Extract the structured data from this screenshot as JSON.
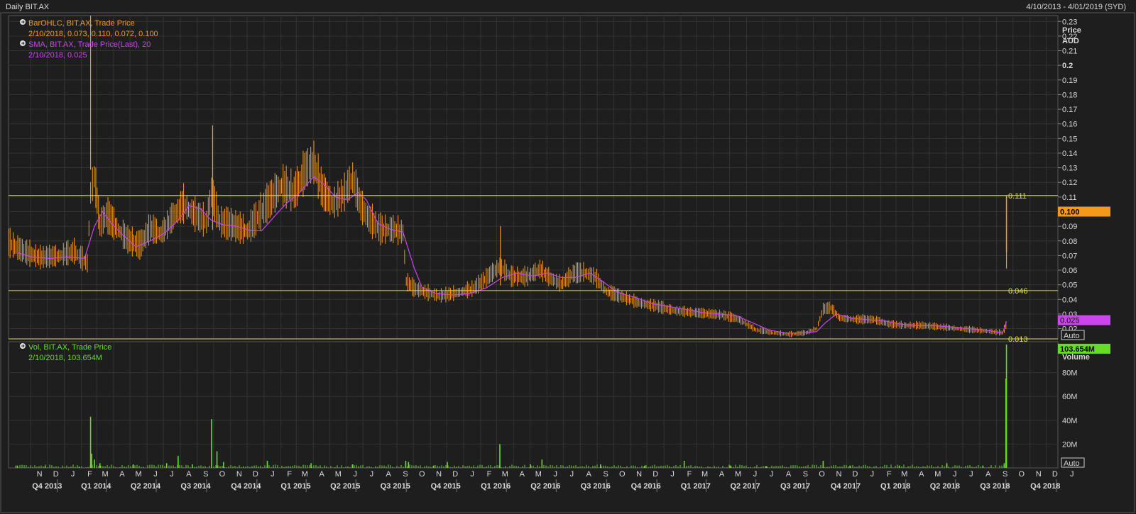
{
  "header": {
    "title": "Daily BIT.AX",
    "date_range": "4/10/2013 - 4/01/2019 (SYD)"
  },
  "legend": {
    "ohlc_line1": "BarOHLC, BIT.AX, Trade Price",
    "ohlc_line2": "2/10/2018, 0.073, 0.110, 0.072, 0.100",
    "sma_line1": "SMA, BIT.AX, Trade Price(Last),  20",
    "sma_line2": "2/10/2018, 0.025",
    "vol_line1": "Vol, BIT.AX, Trade Price",
    "vol_line2": "2/10/2018, 103.654M"
  },
  "price_axis": {
    "label": "Price",
    "unit": "AUD",
    "ticks": [
      "0.23",
      "0.22",
      "0.21",
      "0.2",
      "0.19",
      "0.18",
      "0.17",
      "0.16",
      "0.15",
      "0.14",
      "0.13",
      "0.12",
      "0.11",
      "0.1",
      "0.09",
      "0.08",
      "0.07",
      "0.06",
      "0.05",
      "0.04",
      "0.03",
      "0.02"
    ],
    "last_price": "0.100",
    "last_sma": "0.025",
    "auto_label": "Auto"
  },
  "volume_axis": {
    "label": "Volume",
    "ticks": [
      "80M",
      "60M",
      "40M",
      "20M"
    ],
    "last_volume": "103.654M",
    "auto_label": "Auto"
  },
  "h_lines": [
    {
      "value": 0.111,
      "label": "0.111"
    },
    {
      "value": 0.046,
      "label": "0.046"
    },
    {
      "value": 0.013,
      "label": "0.013"
    }
  ],
  "x_axis": {
    "months": [
      "N",
      "D",
      "J",
      "F",
      "M",
      "A",
      "M",
      "J",
      "J",
      "A",
      "S",
      "O",
      "N",
      "D",
      "J",
      "F",
      "M",
      "A",
      "M",
      "J",
      "J",
      "A",
      "S",
      "O",
      "N",
      "D",
      "J",
      "F",
      "M",
      "A",
      "M",
      "J",
      "J",
      "A",
      "S",
      "O",
      "N",
      "D",
      "J",
      "F",
      "M",
      "A",
      "M",
      "J",
      "J",
      "A",
      "S",
      "O",
      "N",
      "D",
      "J",
      "F",
      "M",
      "A",
      "M",
      "J",
      "J",
      "A",
      "S",
      "O",
      "N",
      "D",
      "J"
    ],
    "quarters": [
      "Q4 2013",
      "Q1 2014",
      "Q2 2014",
      "Q3 2014",
      "Q4 2014",
      "Q1 2015",
      "Q2 2015",
      "Q3 2015",
      "Q4 2015",
      "Q1 2016",
      "Q2 2016",
      "Q3 2016",
      "Q4 2016",
      "Q1 2017",
      "Q2 2017",
      "Q3 2017",
      "Q4 2017",
      "Q1 2018",
      "Q2 2018",
      "Q3 2018",
      "Q4 2018"
    ]
  },
  "colors": {
    "background": "#1e1e1e",
    "grid": "#333333",
    "ohlc": "#f39a1c",
    "sma": "#cc44ee",
    "volume": "#66dd22",
    "hline": "#e6e62a",
    "axis_text": "#d8d8d8"
  },
  "chart_data": {
    "type": "line",
    "title": "Daily BIT.AX",
    "x_range": [
      "2013-10-04",
      "2019-01-04"
    ],
    "price_ylim": [
      0.013,
      0.234
    ],
    "volume_ylim": [
      0,
      100000000
    ],
    "series": [
      {
        "name": "BarOHLC, BIT.AX, Trade Price",
        "kind": "ohlc-close",
        "points": [
          [
            "2013-10-04",
            0.078
          ],
          [
            "2013-11-01",
            0.072
          ],
          [
            "2013-12-01",
            0.068
          ],
          [
            "2014-01-01",
            0.069
          ],
          [
            "2014-02-01",
            0.072
          ],
          [
            "2014-02-25",
            0.064
          ],
          [
            "2014-03-03",
            0.112
          ],
          [
            "2014-03-10",
            0.123
          ],
          [
            "2014-03-20",
            0.09
          ],
          [
            "2014-04-01",
            0.097
          ],
          [
            "2014-04-20",
            0.088
          ],
          [
            "2014-05-10",
            0.08
          ],
          [
            "2014-06-01",
            0.076
          ],
          [
            "2014-06-20",
            0.088
          ],
          [
            "2014-07-10",
            0.084
          ],
          [
            "2014-08-01",
            0.096
          ],
          [
            "2014-08-20",
            0.104
          ],
          [
            "2014-09-10",
            0.097
          ],
          [
            "2014-10-01",
            0.092
          ],
          [
            "2014-10-10",
            0.112
          ],
          [
            "2014-10-25",
            0.092
          ],
          [
            "2014-11-15",
            0.09
          ],
          [
            "2014-12-15",
            0.086
          ],
          [
            "2015-01-05",
            0.097
          ],
          [
            "2015-01-25",
            0.107
          ],
          [
            "2015-02-15",
            0.117
          ],
          [
            "2015-03-10",
            0.112
          ],
          [
            "2015-04-01",
            0.128
          ],
          [
            "2015-04-15",
            0.132
          ],
          [
            "2015-05-01",
            0.113
          ],
          [
            "2015-05-20",
            0.104
          ],
          [
            "2015-06-10",
            0.112
          ],
          [
            "2015-06-25",
            0.122
          ],
          [
            "2015-07-10",
            0.103
          ],
          [
            "2015-07-25",
            0.094
          ],
          [
            "2015-08-15",
            0.087
          ],
          [
            "2015-09-10",
            0.087
          ],
          [
            "2015-09-25",
            0.085
          ],
          [
            "2015-10-01",
            0.052
          ],
          [
            "2015-10-15",
            0.047
          ],
          [
            "2015-11-10",
            0.044
          ],
          [
            "2015-12-01",
            0.042
          ],
          [
            "2016-01-01",
            0.044
          ],
          [
            "2016-02-01",
            0.047
          ],
          [
            "2016-03-01",
            0.056
          ],
          [
            "2016-03-20",
            0.062
          ],
          [
            "2016-04-10",
            0.055
          ],
          [
            "2016-05-10",
            0.055
          ],
          [
            "2016-06-01",
            0.06
          ],
          [
            "2016-06-20",
            0.054
          ],
          [
            "2016-07-10",
            0.05
          ],
          [
            "2016-08-01",
            0.057
          ],
          [
            "2016-08-20",
            0.058
          ],
          [
            "2016-09-10",
            0.055
          ],
          [
            "2016-10-01",
            0.045
          ],
          [
            "2016-11-01",
            0.041
          ],
          [
            "2016-12-01",
            0.037
          ],
          [
            "2017-01-01",
            0.035
          ],
          [
            "2017-02-01",
            0.032
          ],
          [
            "2017-03-01",
            0.031
          ],
          [
            "2017-04-01",
            0.03
          ],
          [
            "2017-05-01",
            0.029
          ],
          [
            "2017-06-01",
            0.026
          ],
          [
            "2017-07-01",
            0.019
          ],
          [
            "2017-08-01",
            0.017
          ],
          [
            "2017-09-01",
            0.016
          ],
          [
            "2017-10-01",
            0.017
          ],
          [
            "2017-10-20",
            0.02
          ],
          [
            "2017-11-01",
            0.033
          ],
          [
            "2017-11-15",
            0.034
          ],
          [
            "2017-12-01",
            0.027
          ],
          [
            "2018-01-01",
            0.026
          ],
          [
            "2018-02-01",
            0.026
          ],
          [
            "2018-03-01",
            0.023
          ],
          [
            "2018-04-01",
            0.022
          ],
          [
            "2018-05-01",
            0.022
          ],
          [
            "2018-06-01",
            0.021
          ],
          [
            "2018-07-01",
            0.02
          ],
          [
            "2018-08-01",
            0.019
          ],
          [
            "2018-09-01",
            0.018
          ],
          [
            "2018-09-25",
            0.017
          ],
          [
            "2018-10-01",
            0.022
          ],
          [
            "2018-10-02",
            0.1
          ]
        ]
      },
      {
        "name": "SMA, BIT.AX, Trade Price(Last),  20",
        "kind": "line",
        "points": [
          [
            "2013-10-20",
            0.072
          ],
          [
            "2013-11-15",
            0.069
          ],
          [
            "2013-12-20",
            0.068
          ],
          [
            "2014-01-20",
            0.069
          ],
          [
            "2014-02-20",
            0.068
          ],
          [
            "2014-03-10",
            0.09
          ],
          [
            "2014-03-25",
            0.1
          ],
          [
            "2014-04-10",
            0.092
          ],
          [
            "2014-05-01",
            0.084
          ],
          [
            "2014-05-25",
            0.076
          ],
          [
            "2014-06-20",
            0.08
          ],
          [
            "2014-07-15",
            0.085
          ],
          [
            "2014-08-10",
            0.094
          ],
          [
            "2014-08-30",
            0.104
          ],
          [
            "2014-09-20",
            0.102
          ],
          [
            "2014-10-10",
            0.094
          ],
          [
            "2014-11-01",
            0.091
          ],
          [
            "2014-11-25",
            0.09
          ],
          [
            "2014-12-20",
            0.087
          ],
          [
            "2015-01-10",
            0.087
          ],
          [
            "2015-02-05",
            0.098
          ],
          [
            "2015-02-25",
            0.106
          ],
          [
            "2015-03-20",
            0.113
          ],
          [
            "2015-04-15",
            0.124
          ],
          [
            "2015-05-05",
            0.118
          ],
          [
            "2015-05-25",
            0.11
          ],
          [
            "2015-06-15",
            0.108
          ],
          [
            "2015-07-05",
            0.113
          ],
          [
            "2015-07-20",
            0.108
          ],
          [
            "2015-08-10",
            0.092
          ],
          [
            "2015-09-01",
            0.088
          ],
          [
            "2015-09-25",
            0.086
          ],
          [
            "2015-10-15",
            0.062
          ],
          [
            "2015-10-30",
            0.048
          ],
          [
            "2015-11-25",
            0.044
          ],
          [
            "2015-12-25",
            0.043
          ],
          [
            "2016-01-25",
            0.044
          ],
          [
            "2016-02-25",
            0.048
          ],
          [
            "2016-03-25",
            0.055
          ],
          [
            "2016-04-20",
            0.058
          ],
          [
            "2016-05-20",
            0.056
          ],
          [
            "2016-06-15",
            0.058
          ],
          [
            "2016-07-10",
            0.055
          ],
          [
            "2016-08-05",
            0.055
          ],
          [
            "2016-09-01",
            0.058
          ],
          [
            "2016-09-25",
            0.052
          ],
          [
            "2016-10-20",
            0.045
          ],
          [
            "2016-11-25",
            0.041
          ],
          [
            "2016-12-25",
            0.037
          ],
          [
            "2017-01-25",
            0.035
          ],
          [
            "2017-02-25",
            0.033
          ],
          [
            "2017-03-25",
            0.031
          ],
          [
            "2017-04-25",
            0.03
          ],
          [
            "2017-05-25",
            0.029
          ],
          [
            "2017-06-25",
            0.024
          ],
          [
            "2017-07-25",
            0.019
          ],
          [
            "2017-08-25",
            0.017
          ],
          [
            "2017-09-25",
            0.017
          ],
          [
            "2017-10-20",
            0.018
          ],
          [
            "2017-11-05",
            0.024
          ],
          [
            "2017-11-25",
            0.03
          ],
          [
            "2017-12-25",
            0.027
          ],
          [
            "2018-01-25",
            0.026
          ],
          [
            "2018-02-25",
            0.025
          ],
          [
            "2018-03-25",
            0.023
          ],
          [
            "2018-04-25",
            0.022
          ],
          [
            "2018-05-25",
            0.022
          ],
          [
            "2018-06-25",
            0.021
          ],
          [
            "2018-07-25",
            0.02
          ],
          [
            "2018-08-25",
            0.019
          ],
          [
            "2018-09-25",
            0.017
          ],
          [
            "2018-10-02",
            0.025
          ]
        ]
      },
      {
        "name": "Vol, BIT.AX, Trade Price",
        "kind": "bar",
        "points": [
          [
            "2013-10-20",
            2000000
          ],
          [
            "2013-12-10",
            1500000
          ],
          [
            "2014-02-10",
            1000000
          ],
          [
            "2014-03-03",
            43000000
          ],
          [
            "2014-03-05",
            12000000
          ],
          [
            "2014-03-10",
            7000000
          ],
          [
            "2014-03-20",
            4000000
          ],
          [
            "2014-05-20",
            3000000
          ],
          [
            "2014-07-20",
            4000000
          ],
          [
            "2014-08-10",
            10000000
          ],
          [
            "2014-09-05",
            3000000
          ],
          [
            "2014-10-10",
            41000000
          ],
          [
            "2014-10-20",
            14000000
          ],
          [
            "2014-11-01",
            5000000
          ],
          [
            "2015-01-20",
            6000000
          ],
          [
            "2015-04-10",
            4000000
          ],
          [
            "2015-06-25",
            3000000
          ],
          [
            "2015-09-30",
            6000000
          ],
          [
            "2015-10-05",
            5000000
          ],
          [
            "2015-11-20",
            2000000
          ],
          [
            "2015-12-15",
            5000000
          ],
          [
            "2016-03-20",
            20000000
          ],
          [
            "2016-05-15",
            3000000
          ],
          [
            "2016-06-05",
            7000000
          ],
          [
            "2016-09-20",
            3000000
          ],
          [
            "2016-12-10",
            2000000
          ],
          [
            "2017-02-20",
            6000000
          ],
          [
            "2017-05-15",
            2000000
          ],
          [
            "2017-07-20",
            1500000
          ],
          [
            "2017-11-01",
            6000000
          ],
          [
            "2017-12-20",
            2000000
          ],
          [
            "2018-03-20",
            2000000
          ],
          [
            "2018-06-15",
            4000000
          ],
          [
            "2018-08-20",
            2000000
          ],
          [
            "2018-09-28",
            4000000
          ],
          [
            "2018-10-01",
            75000000
          ],
          [
            "2018-10-02",
            103654000
          ]
        ]
      }
    ]
  }
}
